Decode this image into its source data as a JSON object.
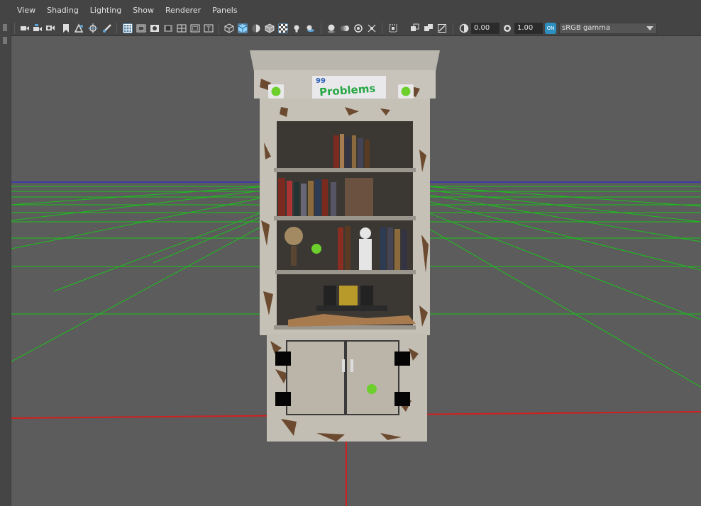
{
  "menu": {
    "items": [
      "View",
      "Shading",
      "Lighting",
      "Show",
      "Renderer",
      "Panels"
    ]
  },
  "toolbar": {
    "exposure_value": "0.00",
    "gamma_value": "1.00",
    "color_management_label": "ON",
    "view_transform": "sRGB gamma",
    "icons": [
      "camera-select-icon",
      "camera-attributes-icon",
      "bookmarks-icon",
      "bookmark-icon",
      "image-plane-icon",
      "2d-pan-zoom-icon",
      "grease-pencil-icon",
      "grid-icon",
      "film-gate-icon",
      "resolution-gate-icon",
      "gate-mask-icon",
      "field-chart-icon",
      "safe-action-icon",
      "safe-title-icon",
      "wireframe-icon",
      "smooth-shade-icon",
      "default-material-icon",
      "wireframe-on-shaded-icon",
      "textured-icon",
      "use-all-lights-icon",
      "shadows-icon",
      "screen-space-ao-icon",
      "motion-blur-icon",
      "multisample-aa-icon",
      "depth-of-field-icon",
      "isolate-select-icon",
      "xray-icon",
      "xray-joints-icon",
      "xray-active-components-icon",
      "exposure-icon",
      "gamma-icon",
      "color-management-icon"
    ]
  },
  "viewport": {
    "colors": {
      "background": "#5c5c5c",
      "grid": "#19c319",
      "x_axis": "#d11f1f",
      "horizon": "#2a2ad0"
    },
    "model_sign_text": "Problems",
    "model_sign_prefix": "99"
  }
}
